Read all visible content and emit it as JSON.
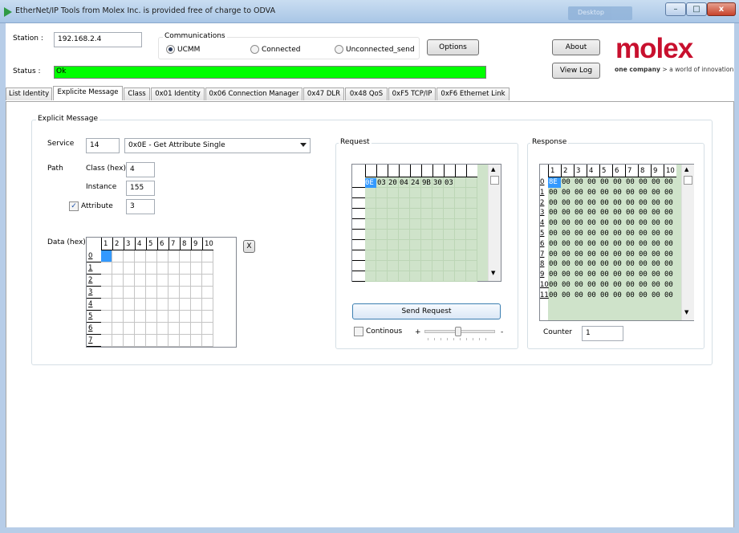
{
  "window": {
    "title": "EtherNet/IP Tools from Molex Inc. is provided free of charge to ODVA",
    "taskbar_chip": "Desktop"
  },
  "controls": {
    "minimize": "–",
    "maximize": "□",
    "close": "x"
  },
  "station": {
    "label": "Station :",
    "value": "192.168.2.4"
  },
  "communications": {
    "title": "Communications",
    "options": [
      {
        "label": "UCMM",
        "selected": true
      },
      {
        "label": "Connected",
        "selected": false
      },
      {
        "label": "Unconnected_send",
        "selected": false
      }
    ]
  },
  "buttons": {
    "options": "Options",
    "about": "About",
    "view_log": "View Log",
    "send_request": "Send Request",
    "clear_data": "X"
  },
  "status": {
    "label": "Status :",
    "value": "Ok",
    "color": "#00ff00"
  },
  "logo": {
    "wordmark": "molex",
    "tagline_bold": "one company",
    "tagline_rest": " > a world of innovation",
    "color": "#c8102e"
  },
  "tabs": [
    {
      "label": "List Identity",
      "active": false
    },
    {
      "label": "Explicite Message",
      "active": true
    },
    {
      "label": "Class",
      "active": false
    },
    {
      "label": "0x01 Identity",
      "active": false
    },
    {
      "label": "0x06 Connection Manager",
      "active": false
    },
    {
      "label": "0x47 DLR",
      "active": false
    },
    {
      "label": "0x48 QoS",
      "active": false
    },
    {
      "label": "0xF5 TCP/IP",
      "active": false
    },
    {
      "label": "0xF6 Ethernet Link",
      "active": false
    }
  ],
  "explicit": {
    "group_title": "Explicit Message",
    "service_label": "Service",
    "service_code": "14",
    "service_selected": "0x0E - Get Attribute Single",
    "path_label": "Path",
    "class_label": "Class (hex)",
    "class_value": "4",
    "instance_label": "Instance",
    "instance_value": "155",
    "attribute_label": "Attribute",
    "attribute_checked": true,
    "attribute_value": "3",
    "data_label": "Data (hex)",
    "data_columns": [
      "1",
      "2",
      "3",
      "4",
      "5",
      "6",
      "7",
      "8",
      "9",
      "10"
    ],
    "data_rows": [
      "0",
      "1",
      "2",
      "3",
      "4",
      "5",
      "6",
      "7"
    ]
  },
  "request": {
    "title": "Request",
    "first_selected": "0E",
    "bytes": [
      "03",
      "20",
      "04",
      "24",
      "9B",
      "30",
      "03"
    ],
    "continous_label": "Continous",
    "continous_checked": false,
    "slider_plus": "+",
    "slider_minus": "-"
  },
  "response": {
    "title": "Response",
    "columns": [
      "1",
      "2",
      "3",
      "4",
      "5",
      "6",
      "7",
      "8",
      "9",
      "10"
    ],
    "rows": [
      {
        "index": "0",
        "cells": [
          "8E",
          "00",
          "00",
          "00",
          "00",
          "00",
          "00",
          "00",
          "00",
          "00"
        ]
      },
      {
        "index": "1",
        "cells": [
          "00",
          "00",
          "00",
          "00",
          "00",
          "00",
          "00",
          "00",
          "00",
          "00"
        ]
      },
      {
        "index": "2",
        "cells": [
          "00",
          "00",
          "00",
          "00",
          "00",
          "00",
          "00",
          "00",
          "00",
          "00"
        ]
      },
      {
        "index": "3",
        "cells": [
          "00",
          "00",
          "00",
          "00",
          "00",
          "00",
          "00",
          "00",
          "00",
          "00"
        ]
      },
      {
        "index": "4",
        "cells": [
          "00",
          "00",
          "00",
          "00",
          "00",
          "00",
          "00",
          "00",
          "00",
          "00"
        ]
      },
      {
        "index": "5",
        "cells": [
          "00",
          "00",
          "00",
          "00",
          "00",
          "00",
          "00",
          "00",
          "00",
          "00"
        ]
      },
      {
        "index": "6",
        "cells": [
          "00",
          "00",
          "00",
          "00",
          "00",
          "00",
          "00",
          "00",
          "00",
          "00"
        ]
      },
      {
        "index": "7",
        "cells": [
          "00",
          "00",
          "00",
          "00",
          "00",
          "00",
          "00",
          "00",
          "00",
          "00"
        ]
      },
      {
        "index": "8",
        "cells": [
          "00",
          "00",
          "00",
          "00",
          "00",
          "00",
          "00",
          "00",
          "00",
          "00"
        ]
      },
      {
        "index": "9",
        "cells": [
          "00",
          "00",
          "00",
          "00",
          "00",
          "00",
          "00",
          "00",
          "00",
          "00"
        ]
      },
      {
        "index": "10",
        "cells": [
          "00",
          "00",
          "00",
          "00",
          "00",
          "00",
          "00",
          "00",
          "00",
          "00"
        ]
      },
      {
        "index": "11",
        "cells": [
          "00",
          "00",
          "00",
          "00",
          "00",
          "00",
          "00",
          "00",
          "00",
          "00"
        ]
      }
    ],
    "counter_label": "Counter",
    "counter_value": "1"
  }
}
